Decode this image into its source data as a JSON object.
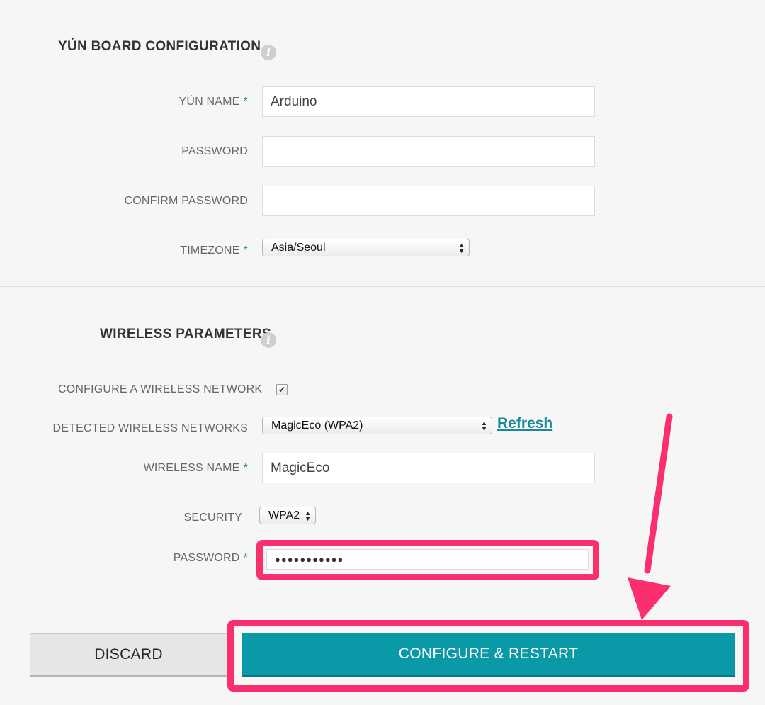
{
  "board": {
    "title": "YÚN BOARD CONFIGURATION",
    "info_icon": "i",
    "name_label": "YÚN NAME",
    "name_value": "Arduino",
    "password_label": "PASSWORD",
    "password_value": "",
    "confirm_label": "CONFIRM PASSWORD",
    "confirm_value": "",
    "timezone_label": "TIMEZONE",
    "timezone_value": "Asia/Seoul"
  },
  "wireless": {
    "title": "WIRELESS PARAMETERS",
    "info_icon": "i",
    "configure_label": "CONFIGURE A WIRELESS NETWORK",
    "configure_checked": true,
    "detected_label": "DETECTED WIRELESS NETWORKS",
    "detected_value": "MagicEco (WPA2)",
    "refresh_label": "Refresh",
    "name_label": "WIRELESS NAME",
    "name_value": "MagicEco",
    "security_label": "SECURITY",
    "security_value": "WPA2",
    "password_label": "PASSWORD",
    "password_masked": "●●●●●●●●●●●"
  },
  "required_mark": "*",
  "actions": {
    "discard_label": "DISCARD",
    "configure_label": "CONFIGURE & RESTART"
  },
  "colors": {
    "accent": "#0a99a6",
    "highlight": "#fb2f6e",
    "required": "#1a8a9a"
  }
}
